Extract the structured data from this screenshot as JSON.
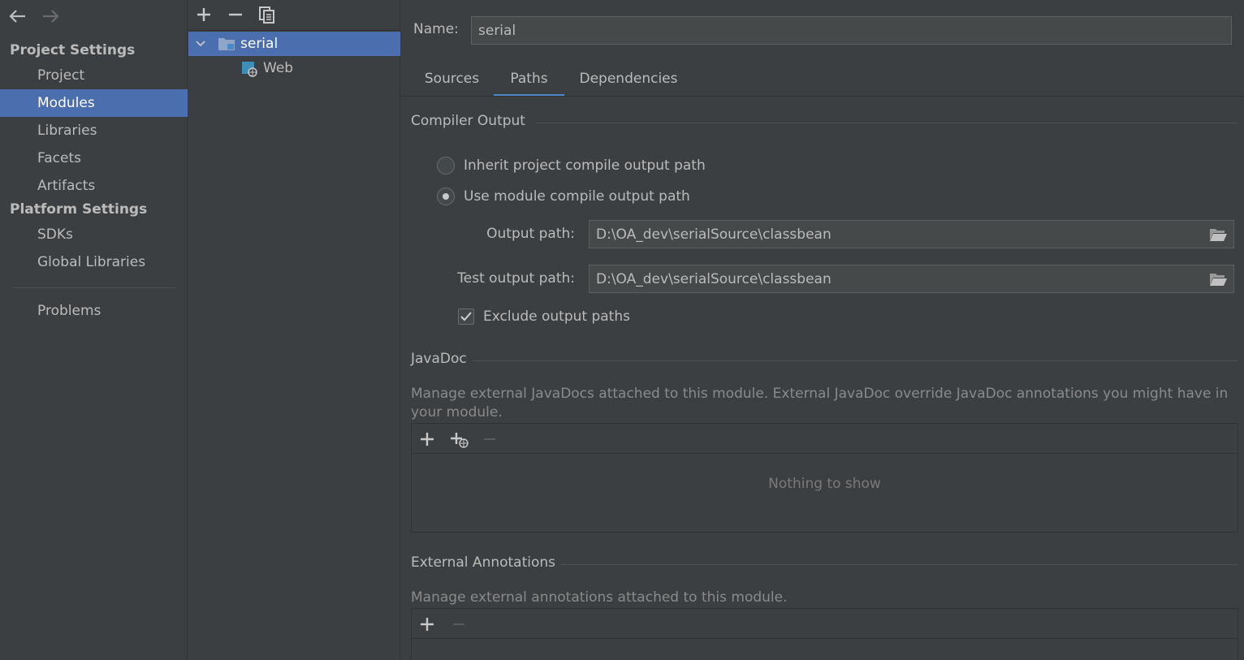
{
  "nav": {
    "back_icon": "arrow-left-icon",
    "forward_icon": "arrow-right-icon",
    "project_settings_heading": "Project Settings",
    "project_items": [
      "Project",
      "Modules",
      "Libraries",
      "Facets",
      "Artifacts"
    ],
    "platform_settings_heading": "Platform Settings",
    "platform_items": [
      "SDKs",
      "Global Libraries"
    ],
    "problems": "Problems",
    "selected": "Modules"
  },
  "tree": {
    "toolbar_icons": [
      "add-icon",
      "remove-icon",
      "copy-icon"
    ],
    "root": "serial",
    "child": "Web"
  },
  "module": {
    "name_label": "Name:",
    "name_value": "serial",
    "tabs": [
      "Sources",
      "Paths",
      "Dependencies"
    ],
    "active_tab": "Paths"
  },
  "compiler_output": {
    "title": "Compiler Output",
    "option_inherit": "Inherit project compile output path",
    "option_module": "Use module compile output path",
    "selected_option": "Use module compile output path",
    "output_path_label": "Output path:",
    "output_path_value": "D:\\OA_dev\\serialSource\\classbean",
    "test_output_path_label": "Test output path:",
    "test_output_path_value": "D:\\OA_dev\\serialSource\\classbean",
    "exclude_label": "Exclude output paths",
    "exclude_checked": true
  },
  "javadoc": {
    "title": "JavaDoc",
    "description": "Manage external JavaDocs attached to this module. External JavaDoc override JavaDoc annotations you might have in your module.",
    "toolbar_icons": [
      "add-icon",
      "add-url-icon",
      "remove-icon"
    ],
    "empty_text": "Nothing to show"
  },
  "external_annotations": {
    "title": "External Annotations",
    "description": "Manage external annotations attached to this module.",
    "toolbar_icons": [
      "add-icon",
      "remove-icon"
    ]
  },
  "colors": {
    "background": "#3c3f41",
    "selection": "#4b6eaf",
    "tab_underline": "#4a88c7",
    "text": "#bbbbbb"
  }
}
